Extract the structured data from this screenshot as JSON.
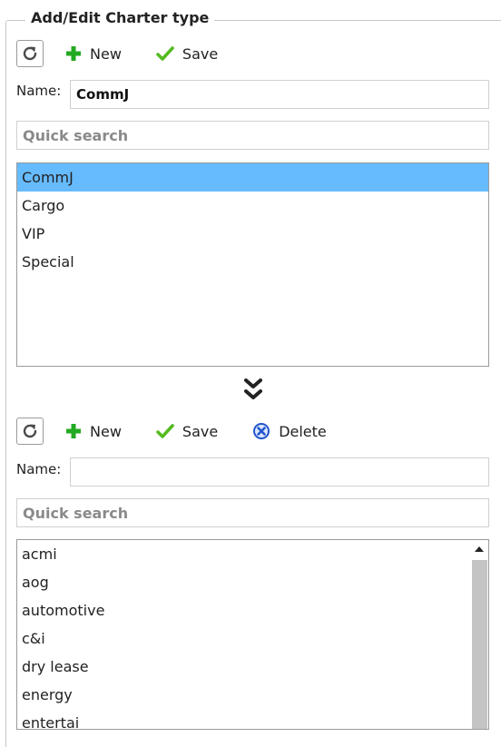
{
  "legend_title": "Add/Edit Charter type",
  "top": {
    "toolbar": {
      "new_label": "New",
      "save_label": "Save"
    },
    "name_label": "Name:",
    "name_value": "CommJ",
    "search_placeholder": "Quick search",
    "items": [
      "CommJ",
      "Cargo",
      "VIP",
      "Special"
    ],
    "selected": "CommJ"
  },
  "bottom": {
    "toolbar": {
      "new_label": "New",
      "save_label": "Save",
      "delete_label": "Delete"
    },
    "name_label": "Name:",
    "name_value": "",
    "search_placeholder": "Quick search",
    "items": [
      "acmi",
      "aog",
      "automotive",
      "c&i",
      "dry lease",
      "energy",
      "entertai"
    ]
  },
  "colors": {
    "selection": "#66bbff",
    "new_icon": "#22aa22",
    "save_icon": "#55bb22",
    "delete_icon": "#2255cc"
  },
  "icons": [
    "refresh-icon",
    "plus-icon",
    "checkmark-icon",
    "delete-icon",
    "double-chevron-down-icon",
    "scroll-up-arrow-icon"
  ]
}
